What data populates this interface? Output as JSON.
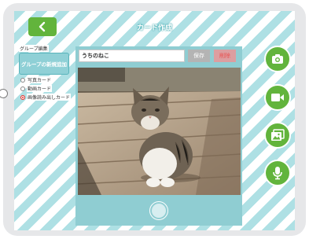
{
  "header": {
    "title": "カード作成",
    "back_icon": "chevron-left-icon"
  },
  "sidebar": {
    "group_label": "グループ編集",
    "group_button": "グループの新規追加",
    "card_types": [
      {
        "label": "写真カード",
        "selected": false
      },
      {
        "label": "動画カード",
        "selected": false
      },
      {
        "label": "画像読み出しカード",
        "selected": true
      }
    ]
  },
  "card": {
    "name_value": "うちのねこ",
    "save_label": "保存",
    "delete_label": "削除",
    "photo_subject": "cat on wooden bench"
  },
  "side_buttons": [
    {
      "icon": "camera-icon"
    },
    {
      "icon": "video-camera-icon"
    },
    {
      "icon": "image-gallery-icon"
    },
    {
      "icon": "microphone-icon"
    }
  ],
  "colors": {
    "accent_green": "#62b43c",
    "teal": "#8fcdd2",
    "stripe": "#aee0e4",
    "delete_red": "#e94f4f"
  }
}
